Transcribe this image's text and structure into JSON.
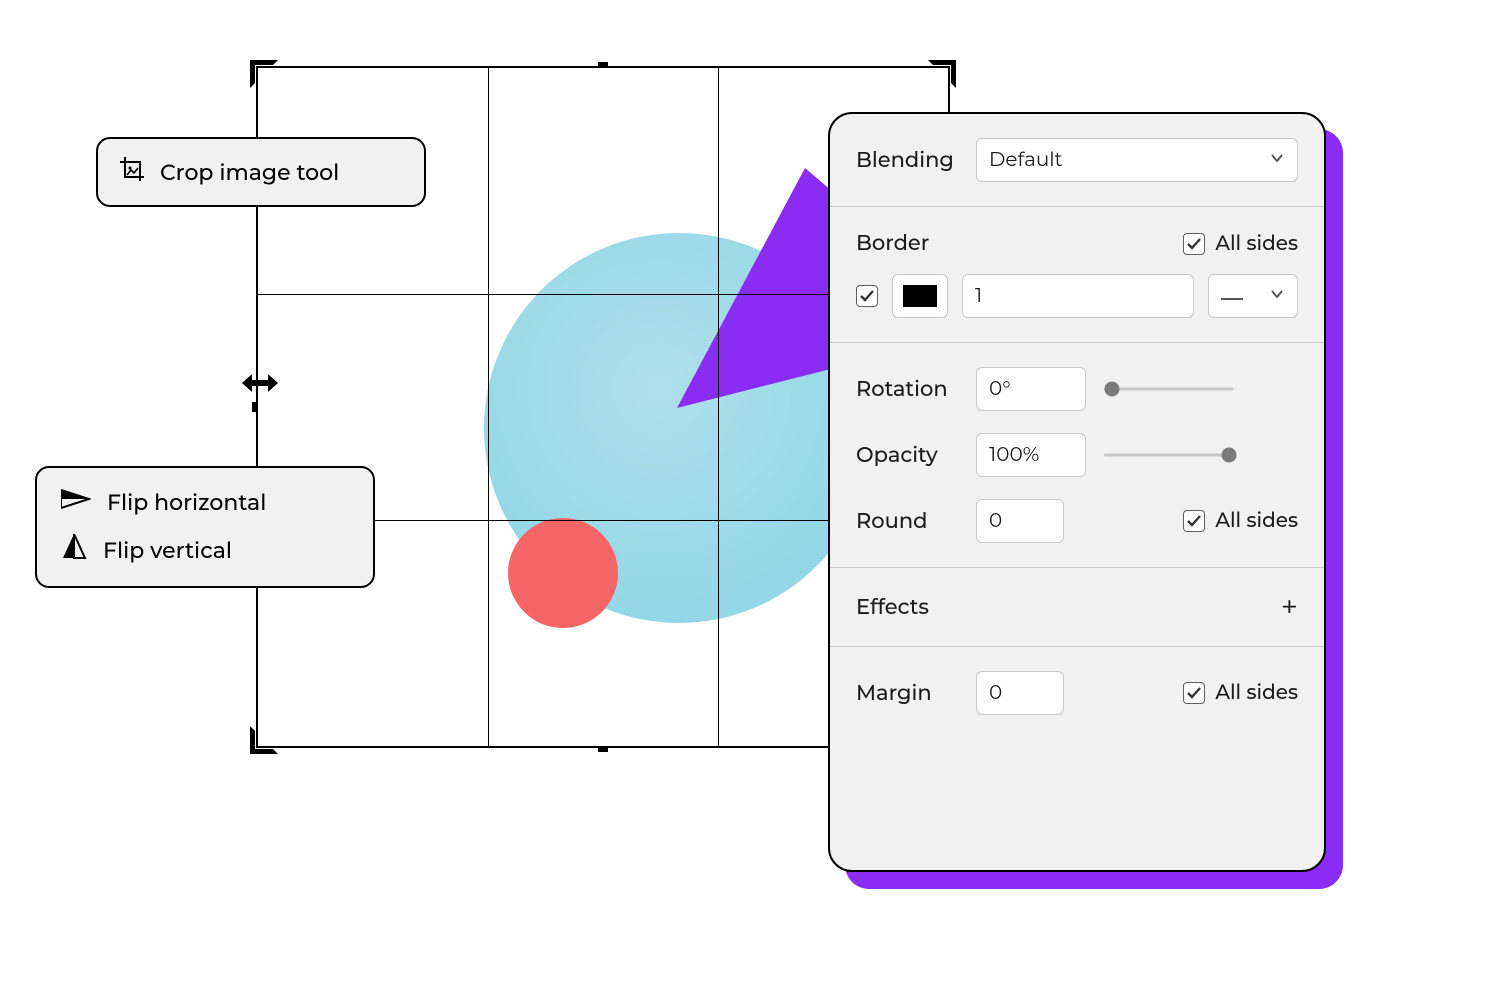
{
  "crop_tool": {
    "label": "Crop image tool"
  },
  "flip": {
    "horizontal_label": "Flip horizontal",
    "vertical_label": "Flip vertical"
  },
  "panel": {
    "blending": {
      "label": "Blending",
      "value": "Default"
    },
    "border": {
      "label": "Border",
      "all_sides_label": "All sides",
      "all_sides_checked": true,
      "enabled_checked": true,
      "color": "#000000",
      "width": "1"
    },
    "rotation": {
      "label": "Rotation",
      "value": "0°",
      "slider_percent": 0
    },
    "opacity": {
      "label": "Opacity",
      "value": "100%",
      "slider_percent": 100
    },
    "round": {
      "label": "Round",
      "value": "0",
      "all_sides_label": "All sides",
      "all_sides_checked": true
    },
    "effects": {
      "label": "Effects"
    },
    "margin": {
      "label": "Margin",
      "value": "0",
      "all_sides_label": "All sides",
      "all_sides_checked": true
    }
  }
}
